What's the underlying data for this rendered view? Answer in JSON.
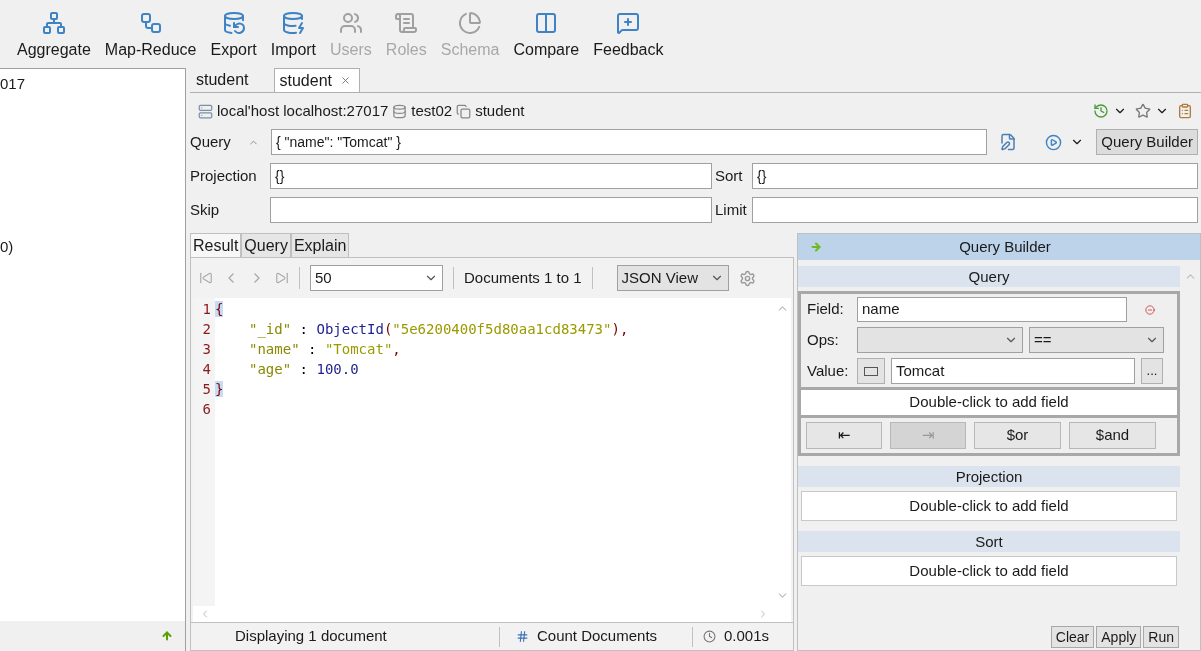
{
  "toolbar": [
    {
      "label": "Aggregate",
      "kind": "aggregate",
      "disabled": false
    },
    {
      "label": "Map-Reduce",
      "kind": "mapreduce",
      "disabled": false
    },
    {
      "label": "Export",
      "kind": "export",
      "disabled": false
    },
    {
      "label": "Import",
      "kind": "import",
      "disabled": false
    },
    {
      "label": "Users",
      "kind": "users",
      "disabled": true
    },
    {
      "label": "Roles",
      "kind": "roles",
      "disabled": true
    },
    {
      "label": "Schema",
      "kind": "schema",
      "disabled": true
    },
    {
      "label": "Compare",
      "kind": "compare",
      "disabled": false
    },
    {
      "label": "Feedback",
      "kind": "feedback",
      "disabled": false
    }
  ],
  "sidebar": {
    "lines": [
      "017",
      "0)"
    ]
  },
  "doc_tabs": [
    {
      "label": "student",
      "selected": false,
      "closable": false
    },
    {
      "label": "student",
      "selected": true,
      "closable": true
    }
  ],
  "breadcrumb": {
    "host": "local'host localhost:27017",
    "database": "test02",
    "collection": "student"
  },
  "query": {
    "label": "Query",
    "value": "{ \"name\": \"Tomcat\" }"
  },
  "query_builder_button": "Query Builder",
  "projection": {
    "label": "Projection",
    "value": "{}"
  },
  "sort": {
    "label": "Sort",
    "value": "{}"
  },
  "skip": {
    "label": "Skip"
  },
  "limit": {
    "label": "Limit"
  },
  "result_tabs": [
    {
      "label": "Result",
      "selected": true
    },
    {
      "label": "Query",
      "selected": false
    },
    {
      "label": "Explain",
      "selected": false
    }
  ],
  "pager": {
    "batch": "50",
    "documents": "Documents 1 to 1",
    "view": "JSON View"
  },
  "code_lines": [
    {
      "number": "1",
      "indented": false,
      "tokens": [
        {
          "kind": "brace",
          "text": "{"
        }
      ]
    },
    {
      "number": "2",
      "indented": true,
      "tokens": [
        {
          "kind": "key",
          "text": "\"_id\""
        },
        {
          "kind": "punct",
          "text": " : "
        },
        {
          "kind": "func",
          "text": "ObjectId"
        },
        {
          "kind": "paren",
          "text": "("
        },
        {
          "kind": "string",
          "text": "\"5e6200400f5d80aa1cd83473\""
        },
        {
          "kind": "paren",
          "text": "),"
        }
      ]
    },
    {
      "number": "3",
      "indented": true,
      "tokens": [
        {
          "kind": "key",
          "text": "\"name\""
        },
        {
          "kind": "punct",
          "text": " : "
        },
        {
          "kind": "string",
          "text": "\"Tomcat\""
        },
        {
          "kind": "paren",
          "text": ","
        }
      ]
    },
    {
      "number": "4",
      "indented": true,
      "tokens": [
        {
          "kind": "key",
          "text": "\"age\""
        },
        {
          "kind": "punct",
          "text": " : "
        },
        {
          "kind": "number",
          "text": "100.0"
        }
      ]
    },
    {
      "number": "5",
      "indented": false,
      "tokens": [
        {
          "kind": "brace",
          "text": "}"
        }
      ]
    },
    {
      "number": "6"
    }
  ],
  "status": {
    "message": "Displaying 1 document",
    "count": "Count Documents",
    "time": "0.001s"
  },
  "query_builder": {
    "title": "Query Builder",
    "query_section": "Query",
    "field_label": "Field:",
    "field_value": "name",
    "ops_label": "Ops:",
    "op_value": "==",
    "value_label": "Value:",
    "value": "Tomcat",
    "more": "...",
    "add_hint": "Double-click to add field",
    "buttons": [
      {
        "label": "⇤",
        "disabled": false
      },
      {
        "label": "⇥",
        "disabled": true
      },
      {
        "label": "$or",
        "disabled": false
      },
      {
        "label": "$and",
        "disabled": false
      }
    ],
    "projection_section": "Projection",
    "projection_hint": "Double-click to add field",
    "sort_section": "Sort",
    "sort_hint": "Double-click to add field",
    "actions": [
      "Clear",
      "Apply",
      "Run"
    ]
  }
}
